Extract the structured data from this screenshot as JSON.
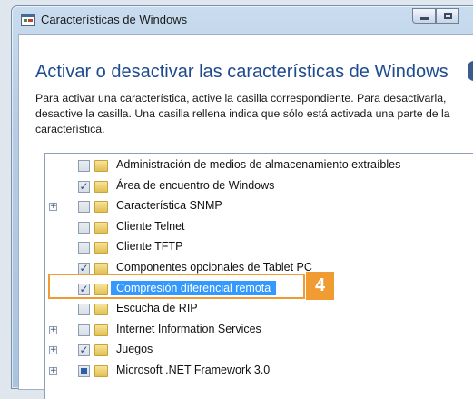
{
  "window": {
    "title": "Características de Windows",
    "icon": "windows-features-icon"
  },
  "heading": "Activar o desactivar las características de Windows",
  "description": "Para activar una característica, active la casilla correspondiente. Para desactivarla, desactive la casilla. Una casilla rellena indica que sólo está activada una parte de la característica.",
  "features": [
    {
      "label": "Administración de medios de almacenamiento extraíbles",
      "state": "unchecked",
      "expandable": false
    },
    {
      "label": "Área de encuentro de Windows",
      "state": "checked",
      "expandable": false
    },
    {
      "label": "Característica SNMP",
      "state": "unchecked",
      "expandable": true
    },
    {
      "label": "Cliente Telnet",
      "state": "unchecked",
      "expandable": false
    },
    {
      "label": "Cliente TFTP",
      "state": "unchecked",
      "expandable": false
    },
    {
      "label": "Componentes opcionales de Tablet PC",
      "state": "checked",
      "expandable": false
    },
    {
      "label": "Compresión diferencial remota",
      "state": "checked",
      "expandable": false,
      "selected": true
    },
    {
      "label": "Escucha de RIP",
      "state": "unchecked",
      "expandable": false
    },
    {
      "label": "Internet Information Services",
      "state": "unchecked",
      "expandable": true
    },
    {
      "label": "Juegos",
      "state": "checked",
      "expandable": true
    },
    {
      "label": "Microsoft .NET Framework 3.0",
      "state": "partial",
      "expandable": true
    }
  ],
  "callout": {
    "number": "4",
    "color": "#f19c33"
  },
  "colors": {
    "heading": "#1e4b8f",
    "selection": "#3399ff"
  }
}
